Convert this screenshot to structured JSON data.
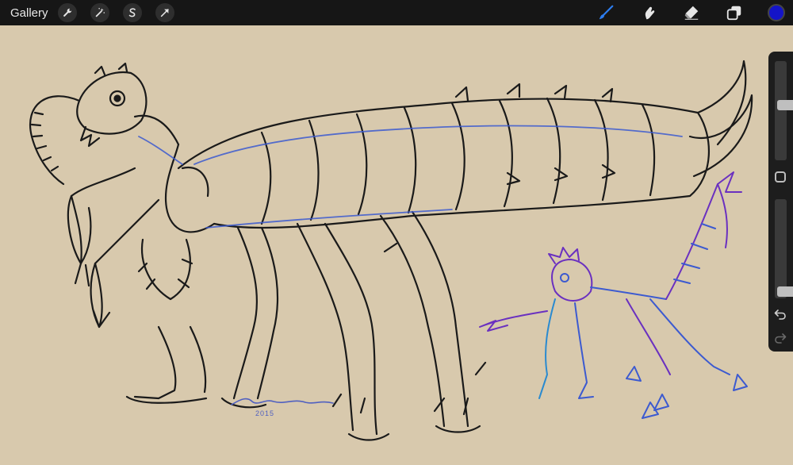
{
  "topbar": {
    "gallery_label": "Gallery",
    "left_tools": [
      {
        "name": "actions",
        "icon": "wrench-icon"
      },
      {
        "name": "adjustments",
        "icon": "magic-wand-icon"
      },
      {
        "name": "selection",
        "icon": "selection-s-icon"
      },
      {
        "name": "transform",
        "icon": "arrow-cursor-icon"
      }
    ],
    "right_tools": [
      {
        "name": "brush",
        "icon": "brush-icon",
        "active": true
      },
      {
        "name": "smudge",
        "icon": "smudge-icon"
      },
      {
        "name": "eraser",
        "icon": "eraser-icon"
      },
      {
        "name": "layers",
        "icon": "layers-icon"
      }
    ],
    "current_color": "#1414c8"
  },
  "canvas": {
    "background_color": "#d8c9ad",
    "ink_color": "#1a1a1a",
    "accent_colors": [
      "#3c5ad0",
      "#6a30c0",
      "#2a8ad0"
    ],
    "signature_year": "2015"
  },
  "sidebar": {
    "brush_size_level": 0.56,
    "opacity_level": 0.02
  }
}
